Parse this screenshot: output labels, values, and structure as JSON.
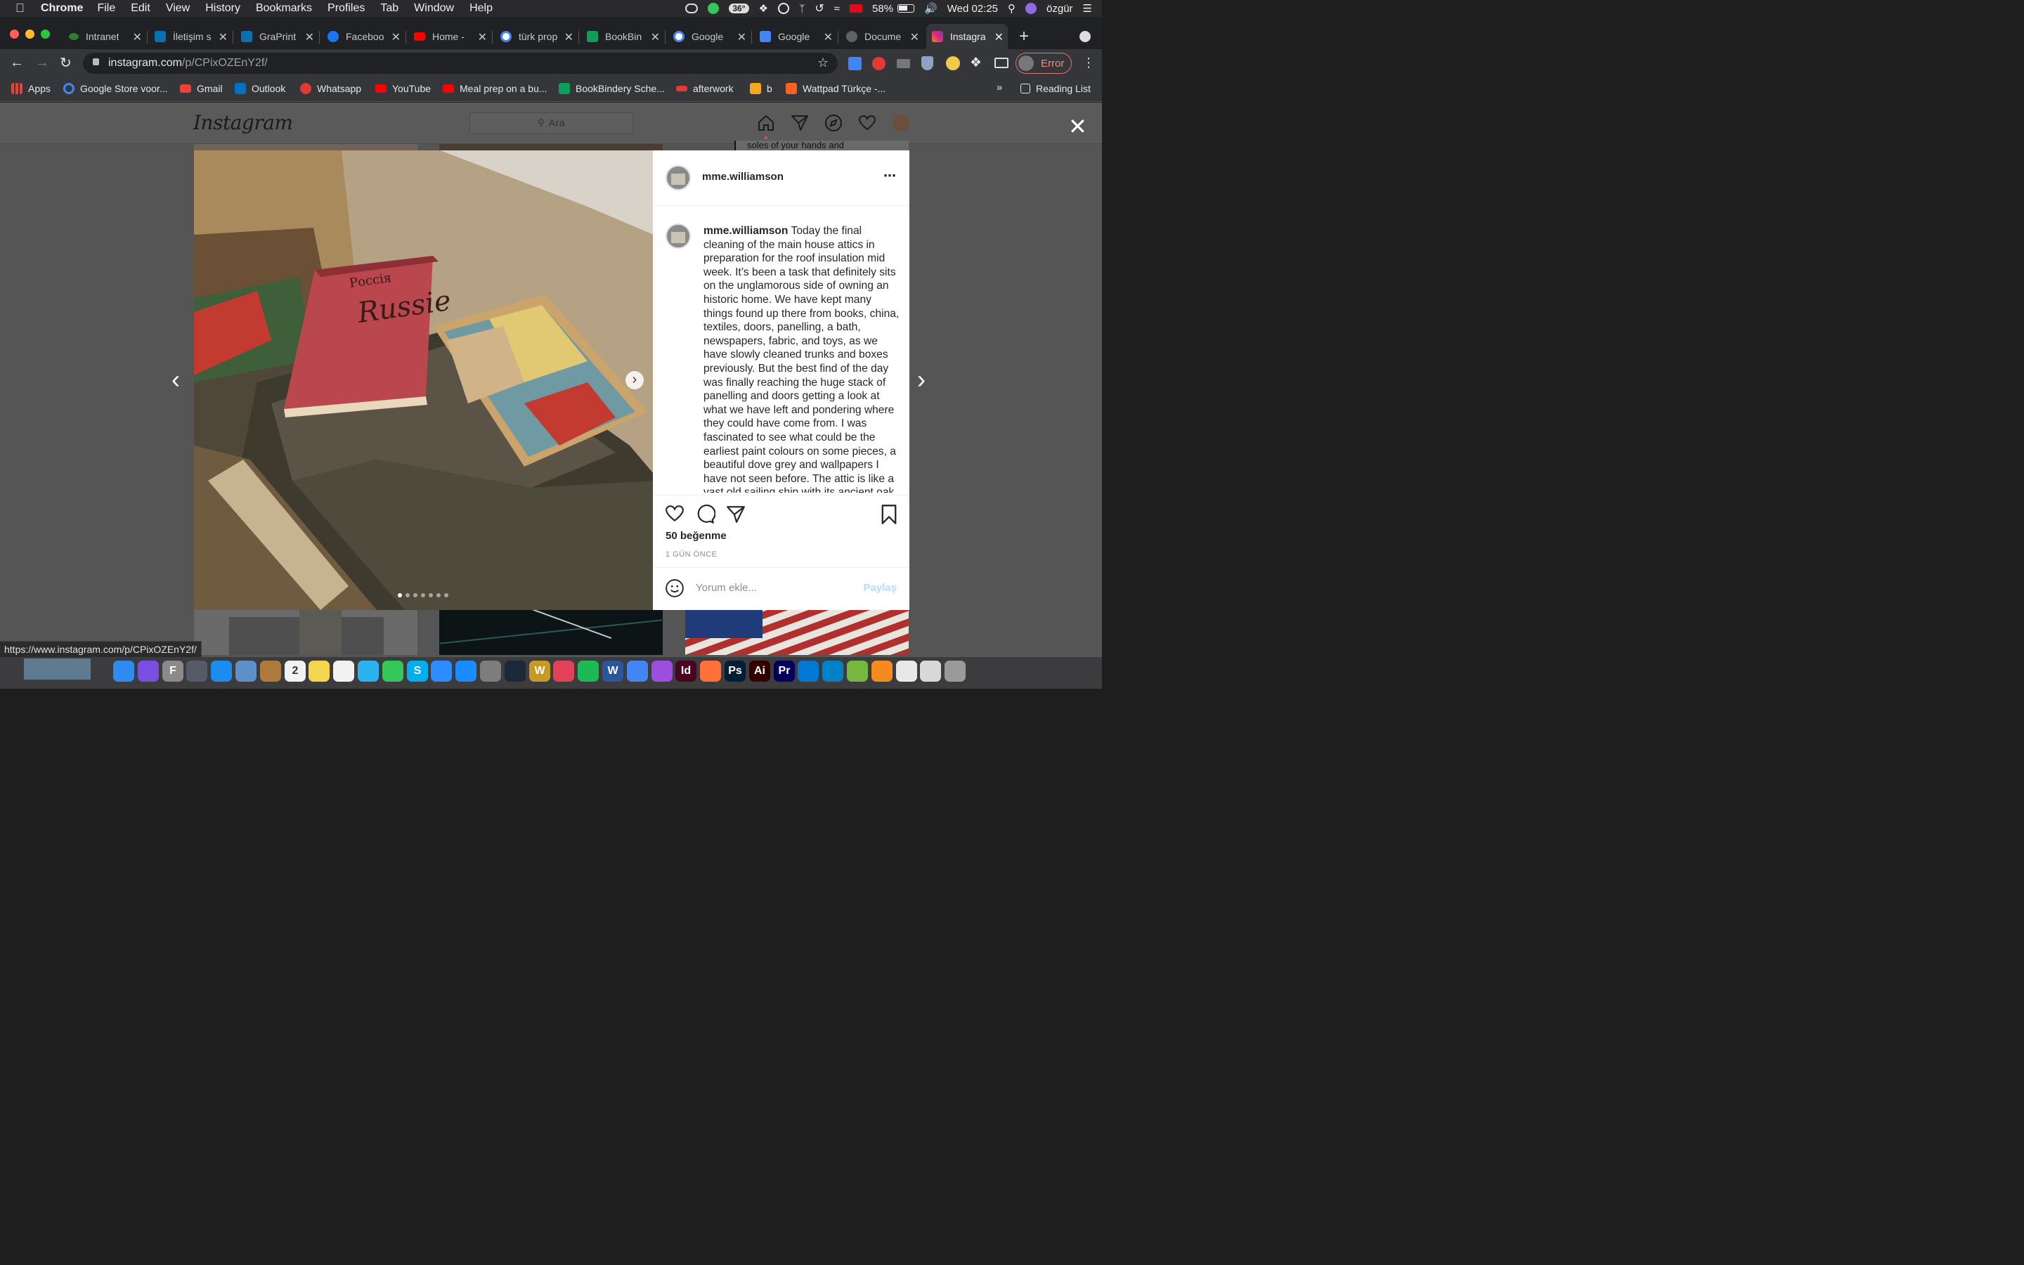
{
  "menubar": {
    "app": "Chrome",
    "items": [
      "File",
      "Edit",
      "View",
      "History",
      "Bookmarks",
      "Profiles",
      "Tab",
      "Window",
      "Help"
    ],
    "temperature": "36°",
    "battery": "58%",
    "clock": "Wed 02:25",
    "user": "özgür"
  },
  "tabs": [
    {
      "title": "Intranet",
      "color": "#2e7d32"
    },
    {
      "title": "İletişim s",
      "color": "#0b6fb0"
    },
    {
      "title": "GraPrint",
      "color": "#0b6fb0"
    },
    {
      "title": "Faceboo",
      "color": "#1877f2"
    },
    {
      "title": "Home - ",
      "color": "#ff0000"
    },
    {
      "title": "türk prop",
      "color": "#ffffff"
    },
    {
      "title": "BookBin",
      "color": "#0f9d58"
    },
    {
      "title": "Google",
      "color": "#ffffff"
    },
    {
      "title": "Google ",
      "color": "#4285f4"
    },
    {
      "title": "Docume",
      "color": "#5f6368"
    },
    {
      "title": "Instagra",
      "color": "#e1306c"
    }
  ],
  "address": {
    "host": "instagram.com",
    "path": "/p/CPixOZEnY2f/",
    "profile_button": "Error"
  },
  "bookmarks": [
    {
      "label": "Apps",
      "color": "#e94235"
    },
    {
      "label": "Google Store voor...",
      "color": "#4285f4"
    },
    {
      "label": "Gmail",
      "color": "#ea4335"
    },
    {
      "label": "Outlook",
      "color": "#0072c6"
    },
    {
      "label": "Whatsapp",
      "color": "#e53935"
    },
    {
      "label": "YouTube",
      "color": "#ff0000"
    },
    {
      "label": "Meal prep on a bu...",
      "color": "#ff0000"
    },
    {
      "label": "BookBindery Sche...",
      "color": "#0f9d58"
    },
    {
      "label": "afterwork",
      "color": "#e53935"
    },
    {
      "label": "b",
      "color": "#f6a623"
    },
    {
      "label": "Wattpad Türkçe -...",
      "color": "#ff6122"
    }
  ],
  "reading_list": "Reading List",
  "instagram": {
    "logo": "Instagram",
    "search_placeholder": "Ara",
    "behind_text": "soles of your hands and"
  },
  "post": {
    "username": "mme.williamson",
    "caption_user": "mme.williamson",
    "caption": "Today the final cleaning of the main house attics in preparation for the roof insulation mid week. It’s been a task that definitely sits on the unglamorous side of owning an historic home. We have kept many things found up there from books, china, textiles, doors, panelling, a bath, newspapers, fabric, and toys, as we have slowly cleaned trunks and boxes previously. But the best find of the day was finally reaching the huge stack of panelling and doors getting a look at what we have left and pondering where they could have come from. I was fascinated to see what could be the earliest paint colours on some pieces, a beautiful dove grey and wallpapers I have not seen before. The attic is like a vast old sailing ship with its ancient oak",
    "book_title": "Russie",
    "book_subtitle": "Россія",
    "likes": "50 beğenme",
    "ago": "1 GÜN ÖNCE",
    "comment_placeholder": "Yorum ekle...",
    "share": "Paylaş",
    "carousel_count": 7,
    "carousel_active": 1
  },
  "status_url": "https://www.instagram.com/p/CPixOZEnY2f/",
  "dock": [
    {
      "name": "finder",
      "label": "",
      "color": "#2f8bf0"
    },
    {
      "name": "siri",
      "label": "",
      "color": "#7a4fe0"
    },
    {
      "name": "fontbook",
      "label": "F",
      "color": "#8a8a8a"
    },
    {
      "name": "launchpad",
      "label": "",
      "color": "#555b66"
    },
    {
      "name": "safari",
      "label": "",
      "color": "#1b8cf0"
    },
    {
      "name": "preview",
      "label": "",
      "color": "#5d8fc9"
    },
    {
      "name": "notes-brown",
      "label": "",
      "color": "#b07a3c"
    },
    {
      "name": "calendar",
      "label": "2",
      "color": "#f2f2f2"
    },
    {
      "name": "notes",
      "label": "",
      "color": "#f4d64e"
    },
    {
      "name": "reminders",
      "label": "",
      "color": "#f2f2f2"
    },
    {
      "name": "messages",
      "label": "",
      "color": "#2bb3f0"
    },
    {
      "name": "facetime",
      "label": "",
      "color": "#34c759"
    },
    {
      "name": "skype",
      "label": "S",
      "color": "#00aff0"
    },
    {
      "name": "zoom",
      "label": "",
      "color": "#2d8cff"
    },
    {
      "name": "appstore",
      "label": "",
      "color": "#1a8cff"
    },
    {
      "name": "settings",
      "label": "",
      "color": "#7d7d7d"
    },
    {
      "name": "steam",
      "label": "",
      "color": "#1b2838"
    },
    {
      "name": "norton",
      "label": "W",
      "color": "#c89a23"
    },
    {
      "name": "game",
      "label": "",
      "color": "#e2415a"
    },
    {
      "name": "spotify",
      "label": "",
      "color": "#1db954"
    },
    {
      "name": "word",
      "label": "W",
      "color": "#2b579a"
    },
    {
      "name": "chrome",
      "label": "",
      "color": "#4285f4"
    },
    {
      "name": "podcasts",
      "label": "",
      "color": "#9b4ee0"
    },
    {
      "name": "indesign",
      "label": "Id",
      "color": "#49021f"
    },
    {
      "name": "firefox",
      "label": "",
      "color": "#ff7139"
    },
    {
      "name": "photoshop",
      "label": "Ps",
      "color": "#001e36"
    },
    {
      "name": "illustrator",
      "label": "Ai",
      "color": "#330000"
    },
    {
      "name": "premiere",
      "label": "Pr",
      "color": "#00005b"
    },
    {
      "name": "vscode",
      "label": "",
      "color": "#0078d4"
    },
    {
      "name": "nextcloud",
      "label": "",
      "color": "#0082c9"
    },
    {
      "name": "utorrent",
      "label": "",
      "color": "#76b83f"
    },
    {
      "name": "vlc",
      "label": "",
      "color": "#f68a1e"
    },
    {
      "name": "textedit",
      "label": "",
      "color": "#e8e8e8"
    },
    {
      "name": "archive",
      "label": "",
      "color": "#d8d8d8"
    },
    {
      "name": "trash",
      "label": "",
      "color": "#9a9a9a"
    }
  ]
}
